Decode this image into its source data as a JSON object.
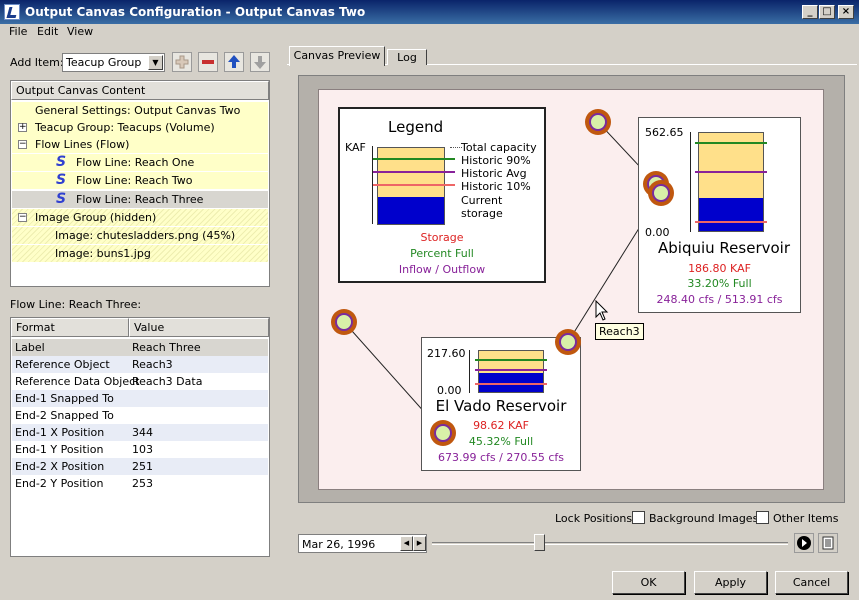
{
  "window": {
    "title": "Output Canvas Configuration - Output Canvas Two"
  },
  "menu": [
    "File",
    "Edit",
    "View"
  ],
  "add_item": {
    "label": "Add Item:",
    "value": "Teacup Group"
  },
  "tree": {
    "header": "Output Canvas Content",
    "items": [
      "General Settings: Output Canvas Two",
      "Teacup Group: Teacups (Volume)",
      "Flow Lines (Flow)",
      "Flow Line: Reach One",
      "Flow Line: Reach Two",
      "Flow Line: Reach Three",
      "Image Group (hidden)",
      "Image: chutesladders.png (45%)",
      "Image: buns1.jpg"
    ]
  },
  "props": {
    "title": "Flow Line: Reach Three:",
    "col_format": "Format",
    "col_value": "Value",
    "rows": [
      {
        "k": "Label",
        "v": "Reach Three"
      },
      {
        "k": "Reference Object",
        "v": "Reach3"
      },
      {
        "k": "Reference Data Object",
        "v": "Reach3 Data"
      },
      {
        "k": "End-1 Snapped To",
        "v": ""
      },
      {
        "k": "End-2 Snapped To",
        "v": ""
      },
      {
        "k": "End-1 X Position",
        "v": "344"
      },
      {
        "k": "End-1 Y Position",
        "v": "103"
      },
      {
        "k": "End-2 X Position",
        "v": "251"
      },
      {
        "k": "End-2 Y Position",
        "v": "253"
      }
    ]
  },
  "tabs": [
    "Canvas Preview",
    "Log"
  ],
  "legend": {
    "title": "Legend",
    "unit": "KAF",
    "items": [
      "Total capacity",
      "Historic 90%",
      "Historic Avg",
      "Historic 10%",
      "Current storage"
    ],
    "storage": "Storage",
    "percent": "Percent Full",
    "flow": "Inflow / Outflow"
  },
  "abiquiu": {
    "name": "Abiquiu Reservoir",
    "max": "562.65",
    "min": "0.00",
    "kaf": "186.80 KAF",
    "pct": "33.20% Full",
    "flow": "248.40 cfs / 513.91 cfs",
    "fill": 0.332
  },
  "elvado": {
    "name": "El Vado Reservoir",
    "max": "217.60",
    "min": "0.00",
    "kaf": "98.62 KAF",
    "pct": "45.32% Full",
    "flow": "673.99 cfs / 270.55 cfs",
    "fill": 0.4532
  },
  "tooltip": "Reach3",
  "lock": {
    "label": "Lock Positions:",
    "bg": "Background Images",
    "other": "Other Items"
  },
  "date": "Mar 26, 1996",
  "buttons": {
    "ok": "OK",
    "apply": "Apply",
    "cancel": "Cancel"
  },
  "colors": {
    "storage": "#dd2222",
    "percent": "#228822",
    "flow": "#882299",
    "current": "#0000cc",
    "capacity": "#ffe08a",
    "h90": "#228822",
    "havg": "#882299",
    "h10": "#ee6666"
  }
}
